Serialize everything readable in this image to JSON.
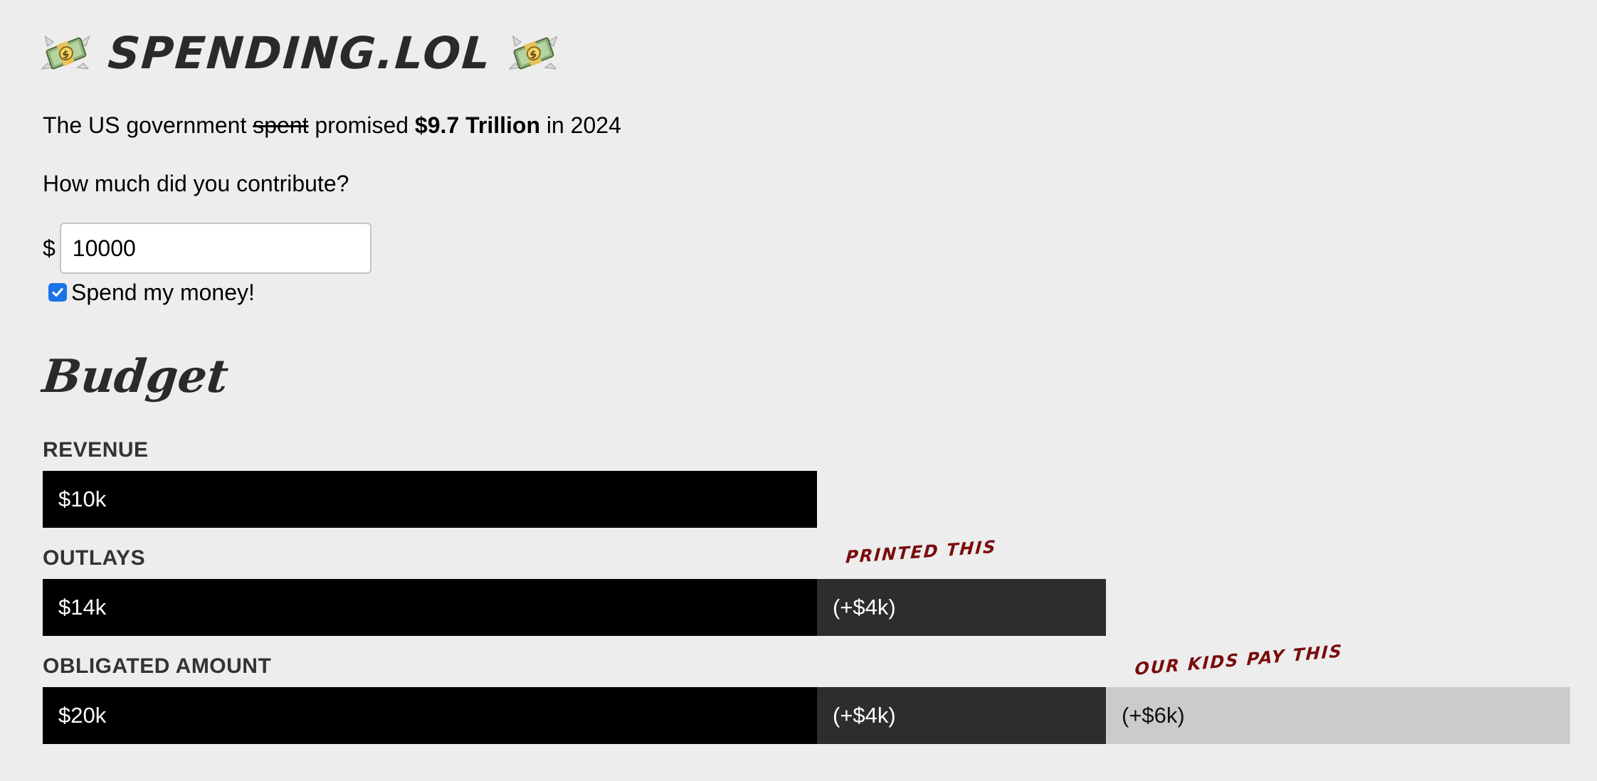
{
  "header": {
    "site_title": "SPENDING.LOL",
    "left_icon": "money-with-wings-icon",
    "right_icon": "money-with-wings-icon"
  },
  "intro": {
    "prefix": "The US government",
    "struck_word": "spent",
    "middle": "promised",
    "amount": "$9.7 Trillion",
    "suffix": "in 2024"
  },
  "question": "How much did you contribute?",
  "contribution": {
    "currency_symbol": "$",
    "value": "10000",
    "checkbox_label": "Spend my money!",
    "checked": true
  },
  "budget": {
    "heading": "Budget",
    "rows": [
      {
        "label": "REVENUE",
        "segments": [
          {
            "text": "$10k",
            "style": "base"
          }
        ]
      },
      {
        "label": "OUTLAYS",
        "note": "PRINTED THIS",
        "segments": [
          {
            "text": "$14k",
            "style": "base"
          },
          {
            "text": "(+$4k)",
            "style": "extra"
          }
        ]
      },
      {
        "label": "OBLIGATED AMOUNT",
        "note": "OUR KIDS PAY THIS",
        "segments": [
          {
            "text": "$20k",
            "style": "base"
          },
          {
            "text": "(+$4k)",
            "style": "extra"
          },
          {
            "text": "(+$6k)",
            "style": "debt"
          }
        ]
      }
    ]
  },
  "colors": {
    "background": "#ededed",
    "bar_base": "#000000",
    "bar_extra": "#2d2d2d",
    "bar_debt": "#cbcbcb",
    "note": "#7a0c0c",
    "checkbox": "#1a73e8"
  }
}
